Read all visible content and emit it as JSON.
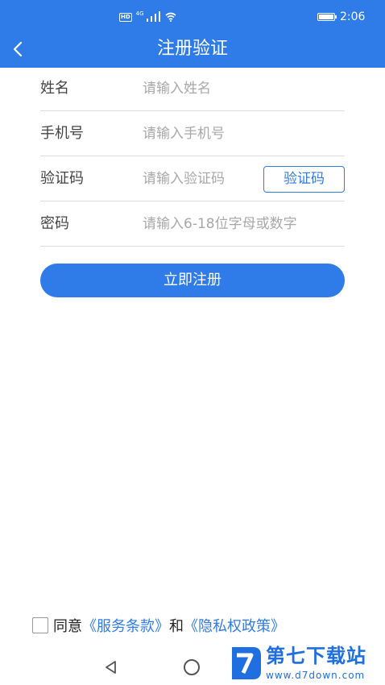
{
  "status_bar": {
    "network_badge": "HD",
    "signal": "4G",
    "time": "2:06"
  },
  "header": {
    "title": "注册验证",
    "back_icon": "chevron-left-icon"
  },
  "form": {
    "name": {
      "label": "姓名",
      "placeholder": "请输入姓名"
    },
    "phone": {
      "label": "手机号",
      "placeholder": "请输入手机号"
    },
    "code": {
      "label": "验证码",
      "placeholder": "请输入验证码",
      "button": "验证码"
    },
    "password": {
      "label": "密码",
      "placeholder": "请输入6-18位字母或数字"
    },
    "submit": "立即注册"
  },
  "agreement": {
    "checked": false,
    "prefix": "同意",
    "terms": "《服务条款》",
    "and": "和",
    "privacy": "《隐私权政策》"
  },
  "watermark": {
    "name": "第七下载站",
    "url": "www.d7down.com"
  },
  "colors": {
    "primary": "#2f7be8",
    "text": "#444444",
    "placeholder": "#a8a8a8",
    "divider": "#dedede"
  }
}
